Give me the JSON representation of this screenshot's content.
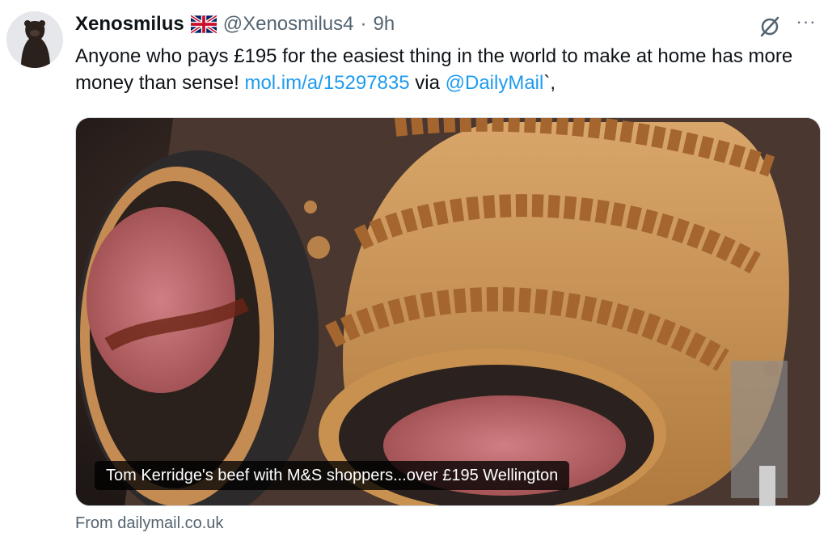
{
  "tweet": {
    "display_name": "Xenosmilus",
    "flag_icon": "uk-flag-icon",
    "handle": "@Xenosmilus4",
    "separator": "·",
    "time": "9h",
    "text_intro": "Anyone who pays £195 for the easiest thing in the world to make at home has more money than sense! ",
    "link_url": "mol.im/a/15297835",
    "text_via": " via ",
    "mention": "@DailyMail",
    "text_end": "`,",
    "more_label": "···"
  },
  "card": {
    "image_alt": "Beef Wellington",
    "caption": "Tom Kerridge's beef with M&S shoppers...over £195 Wellington",
    "source": "From dailymail.co.uk"
  },
  "colors": {
    "link": "#1d9bf0",
    "secondary_text": "#536471",
    "primary_text": "#0f1419"
  }
}
